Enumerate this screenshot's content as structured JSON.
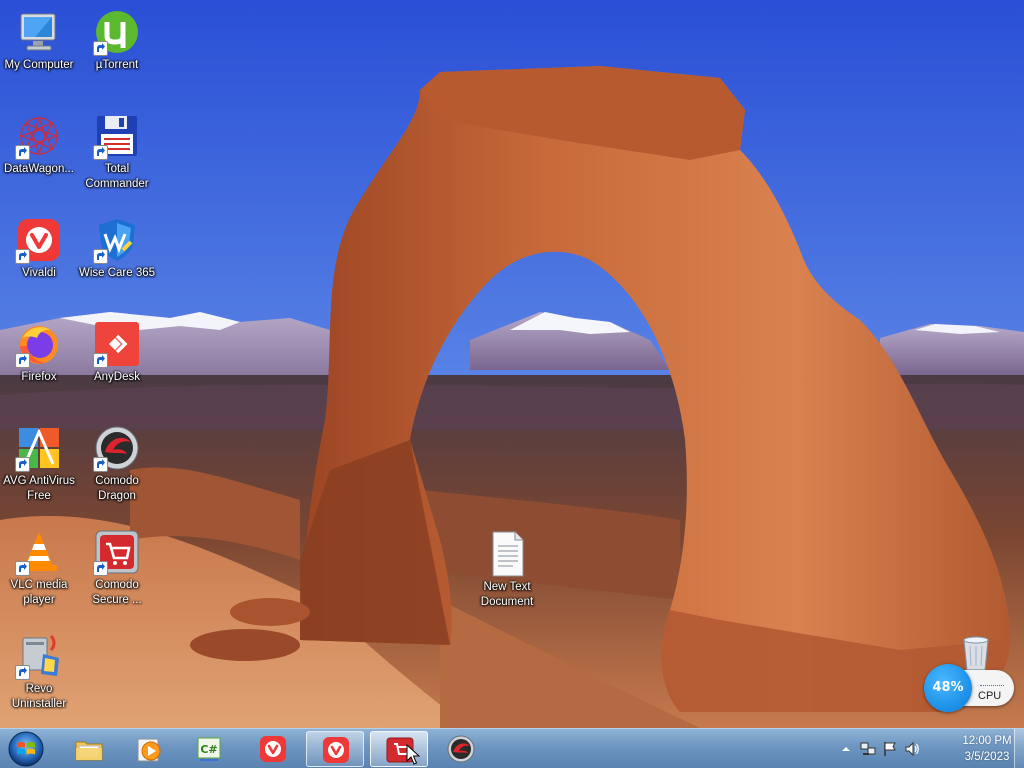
{
  "desktop": {
    "icons": [
      {
        "label": "My Computer"
      },
      {
        "label": "µTorrent"
      },
      {
        "label": "DataWagon..."
      },
      {
        "label": "Total Commander"
      },
      {
        "label": "Vivaldi"
      },
      {
        "label": "Wise Care 365"
      },
      {
        "label": "Firefox"
      },
      {
        "label": "AnyDesk"
      },
      {
        "label": "AVG AntiVirus Free"
      },
      {
        "label": "Comodo Dragon"
      },
      {
        "label": "VLC media player"
      },
      {
        "label": "Comodo Secure ..."
      },
      {
        "label": "Revo Uninstaller"
      },
      {
        "label": "New Text Document"
      }
    ]
  },
  "gadget": {
    "cpu_percent": "48%",
    "cpu_label": "CPU"
  },
  "taskbar": {
    "start_icon": "windows-orb-icon",
    "pinned": [
      {
        "icon": "explorer-folder-icon"
      },
      {
        "icon": "media-player-icon"
      },
      {
        "icon": "csharp-icon"
      },
      {
        "icon": "vivaldi-icon"
      },
      {
        "icon": "vivaldi-icon"
      },
      {
        "icon": "comodo-secure-shopping-icon"
      },
      {
        "icon": "comodo-dragon-icon"
      }
    ],
    "clock": {
      "time": "12:00 PM",
      "date": "3/5/2023"
    }
  },
  "colors": {
    "sky_top": "#2a4fd6",
    "vivaldi_red": "#ef3939",
    "taskbar": "#6d95c0",
    "gadget_blue": "#1a8ee6"
  }
}
